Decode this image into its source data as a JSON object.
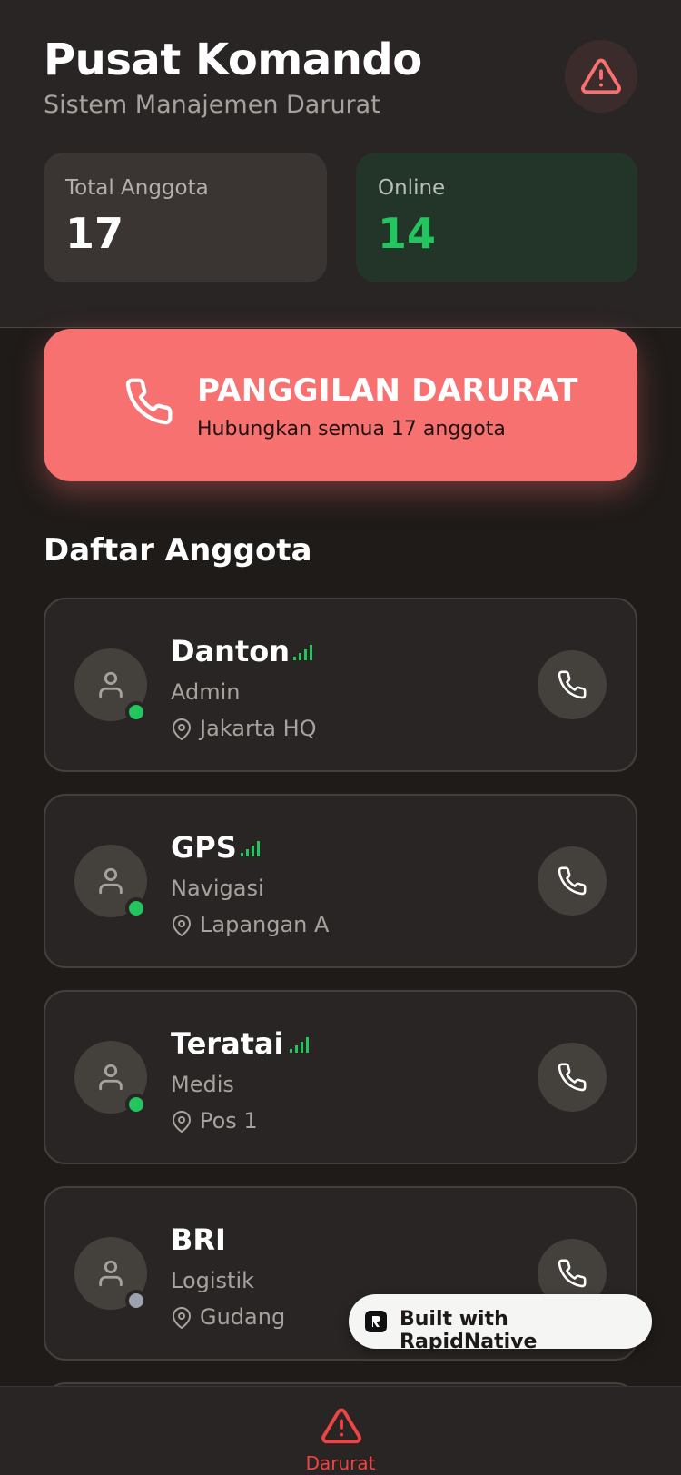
{
  "header": {
    "title": "Pusat Komando",
    "subtitle": "Sistem Manajemen Darurat",
    "alert_icon": "alert-triangle-icon"
  },
  "stats": {
    "total": {
      "label": "Total Anggota",
      "value": "17"
    },
    "online": {
      "label": "Online",
      "value": "14"
    }
  },
  "emergency": {
    "title": "PANGGILAN DARURAT",
    "subtitle": "Hubungkan semua 17 anggota",
    "icon": "phone-icon"
  },
  "members_section": {
    "title": "Daftar Anggota",
    "members": [
      {
        "name": "Danton",
        "role": "Admin",
        "location": "Jakarta HQ",
        "online": true
      },
      {
        "name": "GPS",
        "role": "Navigasi",
        "location": "Lapangan A",
        "online": true
      },
      {
        "name": "Teratai",
        "role": "Medis",
        "location": "Pos 1",
        "online": true
      },
      {
        "name": "BRI",
        "role": "Logistik",
        "location": "Gudang",
        "online": false
      }
    ]
  },
  "badge": {
    "label": "Built with RapidNative"
  },
  "nav": {
    "items": [
      {
        "label": "Darurat",
        "icon": "alert-triangle-icon",
        "active": true
      }
    ]
  },
  "colors": {
    "accent": "#f87171",
    "online": "#22c55e",
    "offline": "#9ca3af",
    "danger": "#ef4444"
  }
}
